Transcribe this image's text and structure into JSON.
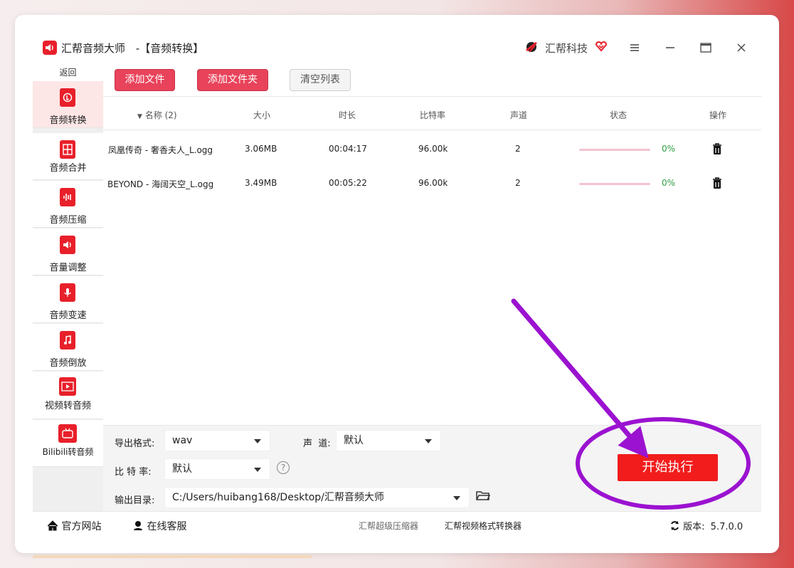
{
  "window": {
    "app_name": "汇帮音频大师",
    "page_title": "-【音频转换】",
    "brand_text": "汇帮科技"
  },
  "sidebar": {
    "back_label": "返回",
    "items": [
      {
        "label": "音频转换",
        "icon": "audio-convert-icon",
        "active": true
      },
      {
        "label": "音频合并",
        "icon": "audio-merge-icon"
      },
      {
        "label": "音频压缩",
        "icon": "audio-compress-icon"
      },
      {
        "label": "音量调整",
        "icon": "volume-icon"
      },
      {
        "label": "音频变速",
        "icon": "microphone-icon"
      },
      {
        "label": "音频倒放",
        "icon": "music-note-icon"
      },
      {
        "label": "视频转音频",
        "icon": "film-icon"
      },
      {
        "label": "Bilibili转音频",
        "icon": "bilibili-tv-icon"
      }
    ]
  },
  "toolbar": {
    "add_file": "添加文件",
    "add_folder": "添加文件夹",
    "clear_list": "清空列表"
  },
  "table": {
    "headers": {
      "name": "名称 (2)",
      "size": "大小",
      "duration": "时长",
      "bitrate": "比特率",
      "channels": "声道",
      "status": "状态",
      "actions": "操作"
    },
    "rows": [
      {
        "name": "凤凰传奇 - 奢香夫人_L.ogg",
        "size": "3.06MB",
        "duration": "00:04:17",
        "bitrate": "96.00k",
        "channels": "2",
        "progress": "0%",
        "progress_value": 0
      },
      {
        "name": "BEYOND - 海阔天空_L.ogg",
        "size": "3.49MB",
        "duration": "00:05:22",
        "bitrate": "96.00k",
        "channels": "2",
        "progress": "0%",
        "progress_value": 0
      }
    ]
  },
  "settings": {
    "format_label": "导出格式:",
    "format_value": "wav",
    "channel_label": "声  道:",
    "channel_value": "默认",
    "bitrate_label": "比 特 率:",
    "bitrate_value": "默认",
    "help_glyph": "?",
    "output_label": "输出目录:",
    "output_value": "C:/Users/huibang168/Desktop/汇帮音频大师",
    "start_button": "开始执行"
  },
  "statusbar": {
    "website": "官方网站",
    "support": "在线客服",
    "link1": "汇帮超级压缩器",
    "link2": "汇帮视频格式转换器",
    "version_label": "版本:",
    "version": "5.7.0.0"
  },
  "colors": {
    "brand_red": "#e8202a",
    "button_red": "#e8435a",
    "start_red": "#f21c1c",
    "annotation_purple": "#9b12d0",
    "progress_green": "#2ea043"
  }
}
